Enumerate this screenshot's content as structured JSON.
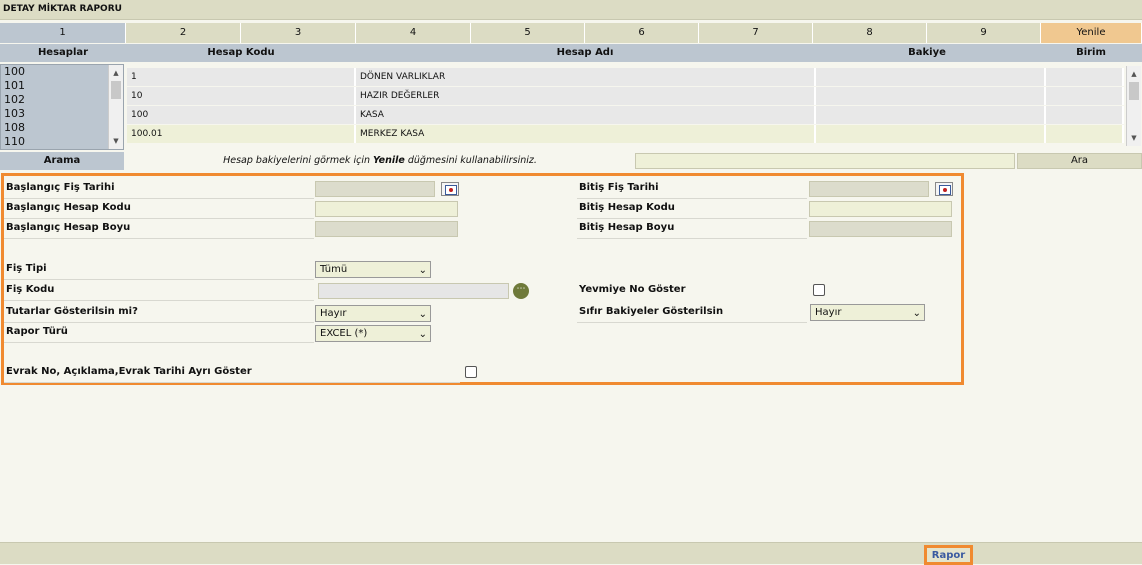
{
  "title": "DETAY MİKTAR RAPORU",
  "tabs": [
    "1",
    "2",
    "3",
    "4",
    "5",
    "6",
    "7",
    "8",
    "9",
    "Yenile"
  ],
  "columns": {
    "hesaplar": "Hesaplar",
    "hesap_kodu": "Hesap Kodu",
    "hesap_adi": "Hesap Adı",
    "bakiye": "Bakiye",
    "birim": "Birim"
  },
  "hesaplar_list": [
    "100",
    "101",
    "102",
    "103",
    "108",
    "110"
  ],
  "grid_rows": [
    {
      "kod": "1",
      "ad": "DÖNEN VARLIKLAR",
      "bakiye": "",
      "birim": ""
    },
    {
      "kod": "10",
      "ad": "HAZIR DEĞERLER",
      "bakiye": "",
      "birim": ""
    },
    {
      "kod": "100",
      "ad": "KASA",
      "bakiye": "",
      "birim": ""
    },
    {
      "kod": "100.01",
      "ad": "MERKEZ KASA",
      "bakiye": "",
      "birim": ""
    }
  ],
  "search": {
    "label": "Arama",
    "hint_pre": "Hesap bakiyelerini görmek için ",
    "hint_bold": "Yenile",
    "hint_post": " düğmesini kullanabilirsiniz.",
    "button": "Ara",
    "value": ""
  },
  "form": {
    "baslangic_fis_tarihi": "Başlangıç Fiş Tarihi",
    "bitis_fis_tarihi": "Bitiş Fiş Tarihi",
    "baslangic_hesap_kodu": "Başlangıç Hesap Kodu",
    "bitis_hesap_kodu": "Bitiş Hesap Kodu",
    "baslangic_hesap_boyu": "Başlangıç Hesap Boyu",
    "bitis_hesap_boyu": "Bitiş Hesap Boyu",
    "fis_tipi": "Fiş Tipi",
    "fis_tipi_value": "Tümü",
    "fis_kodu": "Fiş Kodu",
    "yevmiye_no_goster": "Yevmiye No Göster",
    "tutarlar": "Tutarlar Gösterilsin mi?",
    "tutarlar_value": "Hayır",
    "sifir_bakiyeler": "Sıfır Bakiyeler Gösterilsin",
    "sifir_bakiyeler_value": "Hayır",
    "rapor_turu": "Rapor Türü",
    "rapor_turu_value": "EXCEL (*)",
    "evrak": "Evrak No, Açıklama,Evrak Tarihi Ayrı Göster"
  },
  "footer": {
    "rapor": "Rapor"
  },
  "colors": {
    "accent": "#f08a30",
    "header": "#bcc6d0",
    "bar": "#dcdcc4",
    "link": "#3a5aa0"
  }
}
